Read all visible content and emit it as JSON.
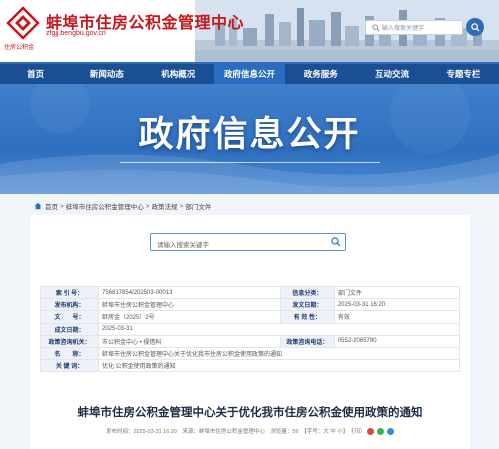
{
  "header": {
    "site_name": "蚌埠市住房公积金管理中心",
    "logo_caption": "住房公积金",
    "domain": "zfgjj.bengbu.gov.cn",
    "search_placeholder": "输入搜索关键字"
  },
  "colors": {
    "brand_red": "#c8161d",
    "nav_blue": "#1b4f94",
    "nav_active": "#2a6cc0",
    "banner_blue": "#2f6fbf"
  },
  "nav": {
    "items": [
      {
        "label": "首页"
      },
      {
        "label": "新闻动态"
      },
      {
        "label": "机构概况"
      },
      {
        "label": "政府信息公开",
        "active": true
      },
      {
        "label": "政务服务"
      },
      {
        "label": "互动交流"
      },
      {
        "label": "专题专栏"
      }
    ]
  },
  "banner": {
    "title": "政府信息公开"
  },
  "breadcrumb": {
    "icon": "home-icon",
    "items": [
      "首页",
      "蚌埠市住房公积金管理中心",
      "政策法规",
      "部门文件"
    ]
  },
  "content_search": {
    "placeholder": "请输入搜索关键字"
  },
  "info": {
    "rows": [
      {
        "l1": "索 引 号：",
        "v1": "756817854/202503-00013",
        "l2": "信息分类：",
        "v2": "部门文件"
      },
      {
        "l1": "发布机构：",
        "v1": "蚌埠市住房公积金管理中心",
        "l2": "发文日期：",
        "v2": "2025-03-31 16:20"
      },
      {
        "l1": "文　　号：",
        "v1": "蚌房金〔2025〕2号",
        "l2": "有 效 性：",
        "v2": "有效"
      },
      {
        "l1": "成文日期：",
        "v1": "2025-03-31"
      },
      {
        "l1": "政策咨询机关：",
        "v1": "市公积金中心 • 侵借科",
        "l2": "政策咨询电话：",
        "v2": "0552-2065790"
      },
      {
        "l1": "名　　称：",
        "v1": "蚌埠市住房公积金管理中心关于优化我市住房公积金使用政策的通知"
      },
      {
        "l1": "关 键 词：",
        "v1": "优化 公积金使用政策的通知"
      }
    ]
  },
  "article": {
    "title": "蚌埠市住房公积金管理中心关于优化我市住房公积金使用政策的通知",
    "meta": "发布时间：2025-03-31 16:20　来源：蚌埠市住房公积金管理中心　浏览量：59　【字号：大 中 小】　打印"
  }
}
